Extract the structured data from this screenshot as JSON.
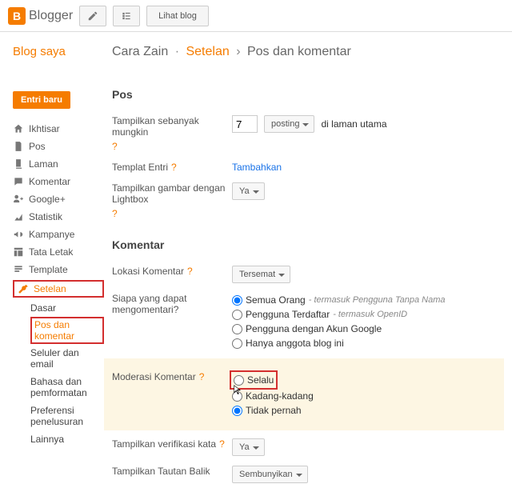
{
  "topbar": {
    "brand": "Blogger",
    "view_blog": "Lihat blog"
  },
  "sidebar": {
    "my_blogs": "Blog saya",
    "new_post": "Entri baru",
    "nav": {
      "overview": "Ikhtisar",
      "posts": "Pos",
      "pages": "Laman",
      "comments": "Komentar",
      "google_plus": "Google+",
      "stats": "Statistik",
      "campaigns": "Kampanye",
      "layout": "Tata Letak",
      "template": "Template",
      "settings": "Setelan"
    },
    "subnav": {
      "basic": "Dasar",
      "posts_comments": "Pos dan komentar",
      "mobile_email": "Seluler dan email",
      "lang_format": "Bahasa dan pemformatan",
      "search_pref": "Preferensi penelusuran",
      "other": "Lainnya"
    }
  },
  "breadcrumb": {
    "blog_name": "Cara Zain",
    "settings": "Setelan",
    "page": "Pos dan komentar"
  },
  "posts": {
    "heading": "Pos",
    "show_max": "Tampilkan sebanyak mungkin",
    "count": "7",
    "posting": "posting",
    "on_main": "di laman utama",
    "post_template": "Templat Entri",
    "add": "Tambahkan",
    "lightbox": "Tampilkan gambar dengan Lightbox",
    "yes": "Ya"
  },
  "comments": {
    "heading": "Komentar",
    "location": "Lokasi Komentar",
    "embedded": "Tersemat",
    "who_can": "Siapa yang dapat mengomentari?",
    "anyone": "Semua Orang",
    "anyone_hint": "- termasuk Pengguna Tanpa Nama",
    "registered": "Pengguna Terdaftar",
    "registered_hint": "- termasuk OpenID",
    "google_users": "Pengguna dengan Akun Google",
    "members_only": "Hanya anggota blog ini",
    "moderation": "Moderasi Komentar",
    "always": "Selalu",
    "sometimes": "Kadang-kadang",
    "never": "Tidak pernah",
    "show_verification": "Tampilkan verifikasi kata",
    "yes2": "Ya",
    "backlinks": "Tampilkan Tautan Balik",
    "hide": "Sembunyikan"
  },
  "help": "?"
}
